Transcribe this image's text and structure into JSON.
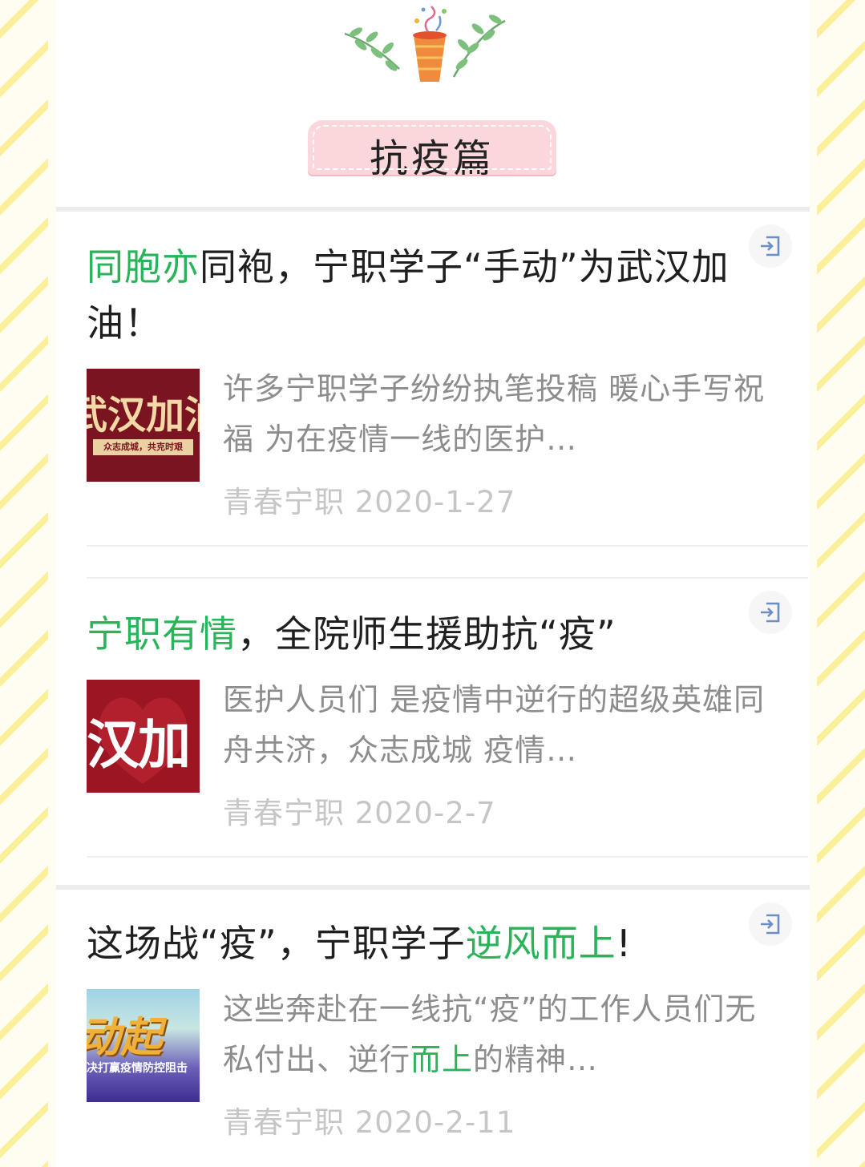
{
  "section": {
    "title": "抗疫篇"
  },
  "articles": [
    {
      "title_highlight_start": "同胞亦",
      "title_rest": "同袍，宁职学子“手动”为武汉加油！",
      "thumbnail_text": "武汉加油",
      "thumbnail_subtext": "众志成城，共克时艰",
      "summary": "许多宁职学子纷纷执笔投稿 暖心手写祝福 为在疫情一线的医护…",
      "source": "青春宁职",
      "date": "2020-1-27",
      "open_icon": "open-in-icon"
    },
    {
      "title_highlight_start": "宁职有情",
      "title_rest": "，全院师生援助抗“疫”",
      "thumbnail_text": "汉加",
      "summary": "医护人员们 是疫情中逆行的超级英雄同舟共济，众志成城 疫情…",
      "source": "青春宁职",
      "date": "2020-2-7",
      "open_icon": "open-in-icon"
    },
    {
      "title_start": "这场战“疫”，宁职学子",
      "title_highlight": "逆风而上",
      "title_end": "!",
      "thumbnail_text": "动起",
      "thumbnail_subtext": "决打赢疫情防控阻击",
      "summary_start": "这些奔赴在一线抗“疫”的工作人员们无私付出、逆行",
      "summary_highlight": "而上",
      "summary_end": "的精神…",
      "source": "青春宁职",
      "date": "2020-2-11",
      "open_icon": "open-in-icon"
    }
  ],
  "colors": {
    "highlight": "#2ab45a",
    "tag_bg": "#fbd6da",
    "stripe": "#fbef9a"
  }
}
